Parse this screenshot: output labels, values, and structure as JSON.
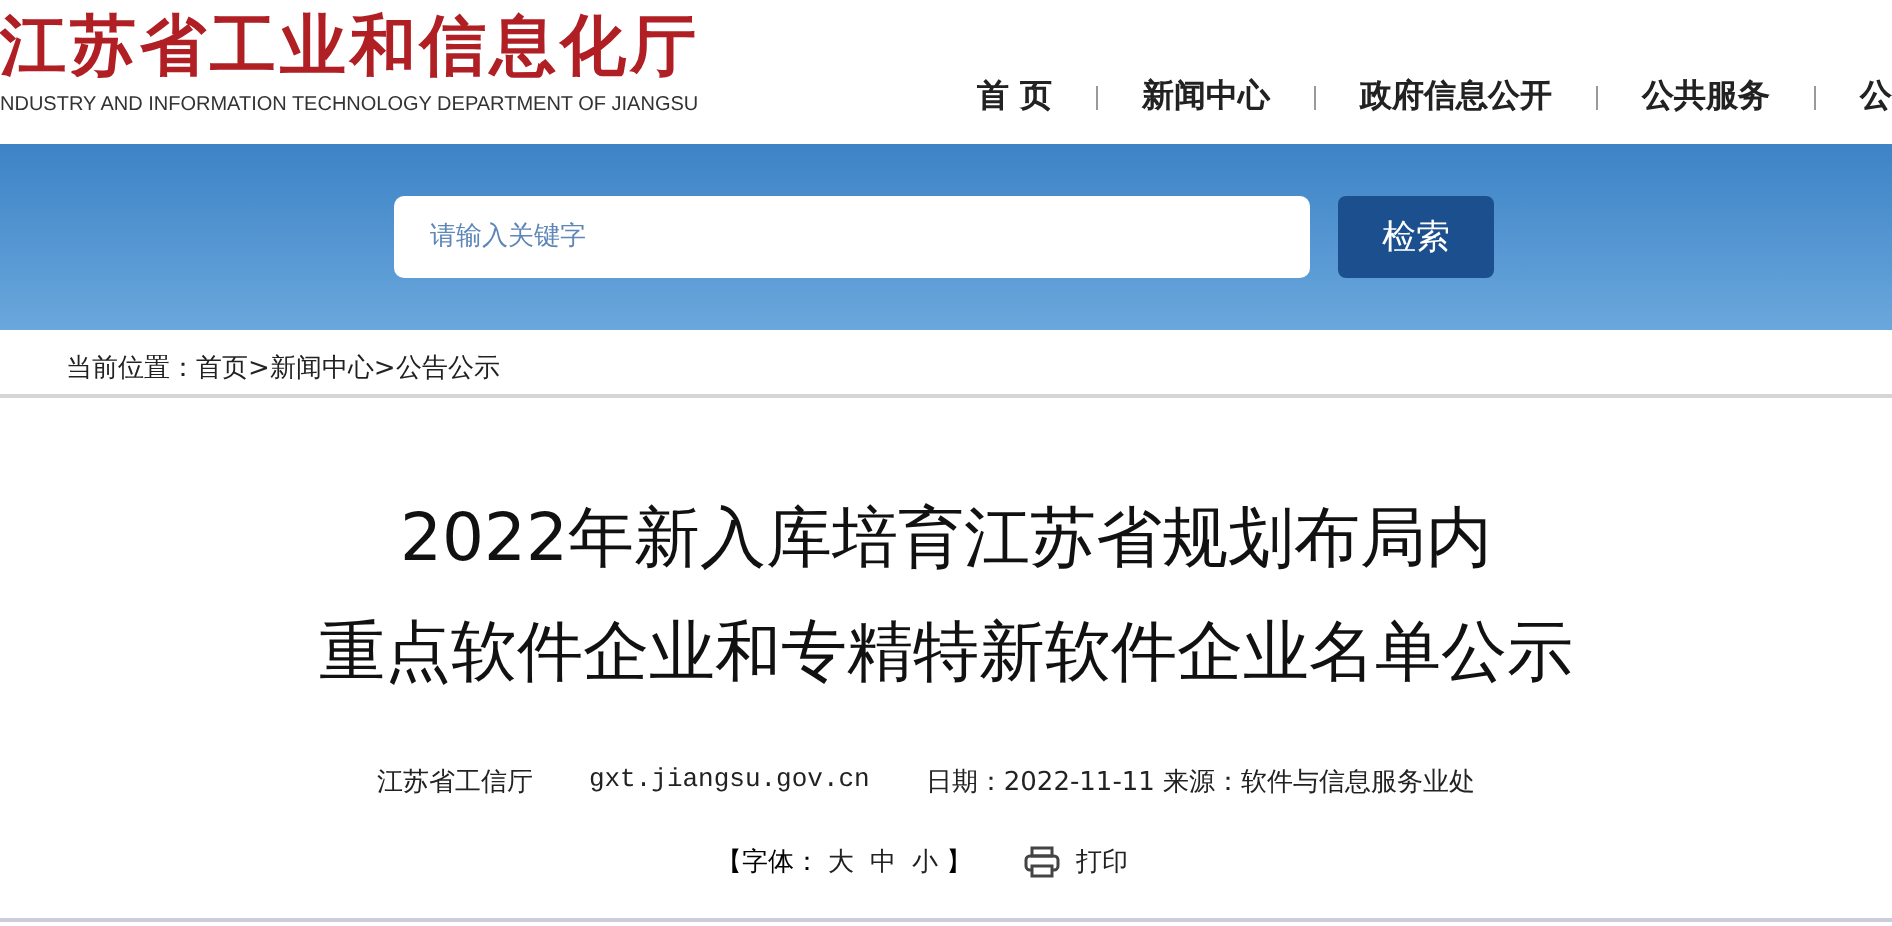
{
  "header": {
    "logo_title": "江苏省工业和信息化厅",
    "logo_subtitle": "NDUSTRY AND INFORMATION TECHNOLOGY DEPARTMENT OF JIANGSU",
    "nav": [
      "首 页",
      "新闻中心",
      "政府信息公开",
      "公共服务",
      "公"
    ]
  },
  "search": {
    "placeholder": "请输入关键字",
    "button": "检索"
  },
  "breadcrumb": "当前位置：首页>新闻中心>公告公示",
  "article": {
    "title_lines": [
      "2022年新入库培育江苏省规划布局内",
      "重点软件企业和专精特新软件企业名单公示"
    ],
    "source": "江苏省工信厅",
    "site": "gxt.jiangsu.gov.cn",
    "date": "日期：2022-11-11 来源：软件与信息服务业处",
    "font_size": {
      "label": "【字体：",
      "options": [
        "大",
        "中",
        "小"
      ],
      "close": "】"
    },
    "print": "打印"
  }
}
